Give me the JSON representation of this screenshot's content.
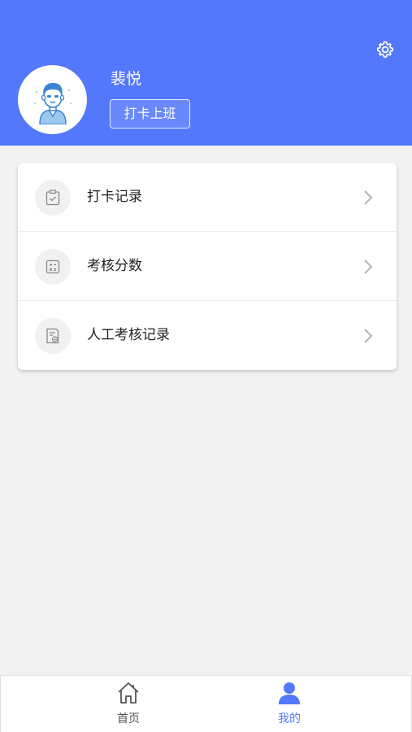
{
  "header": {
    "user_name": "裴悦",
    "clock_in_label": "打卡上班",
    "background_color": "#5478fc",
    "settings_icon": "gear-icon",
    "avatar_icon": "user-avatar-illustration"
  },
  "menu": {
    "items": [
      {
        "label": "打卡记录",
        "icon": "clipboard-check-icon"
      },
      {
        "label": "考核分数",
        "icon": "calculator-icon"
      },
      {
        "label": "人工考核记录",
        "icon": "document-check-icon"
      }
    ]
  },
  "bottom_nav": {
    "items": [
      {
        "label": "首页",
        "icon": "home-icon",
        "active": false
      },
      {
        "label": "我的",
        "icon": "person-icon",
        "active": true
      }
    ],
    "active_color": "#5478fc",
    "inactive_color": "#555555"
  }
}
